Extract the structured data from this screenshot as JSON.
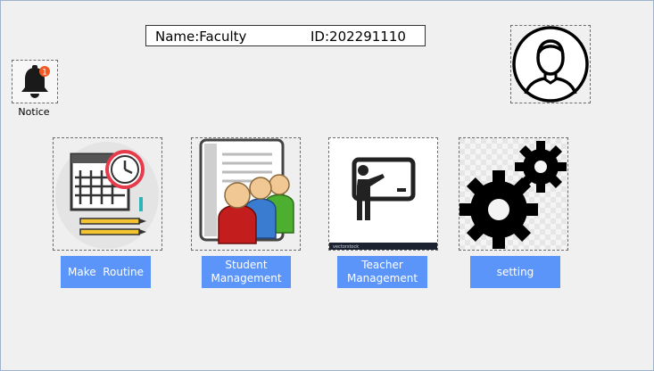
{
  "user": {
    "name_text": "Name:Faculty",
    "id_text": "ID:202291110"
  },
  "notice": {
    "label": "Notice",
    "badge_count": "1",
    "icon": "bell-icon"
  },
  "avatar": {
    "icon": "user-avatar-icon"
  },
  "tiles": [
    {
      "icon": "routine-calendar-clock-icon",
      "button_label": "Make  Routine"
    },
    {
      "icon": "student-management-people-icon",
      "button_label": "Student\nManagement"
    },
    {
      "icon": "teacher-board-icon",
      "button_label": "Teacher\nManagement",
      "watermark": "vectorstock"
    },
    {
      "icon": "settings-gears-icon",
      "button_label": "setting"
    }
  ],
  "colors": {
    "button_bg": "#5b95f9",
    "button_text": "#ffffff",
    "window_bg": "#f0f0f0",
    "badge": "#f15a24"
  }
}
